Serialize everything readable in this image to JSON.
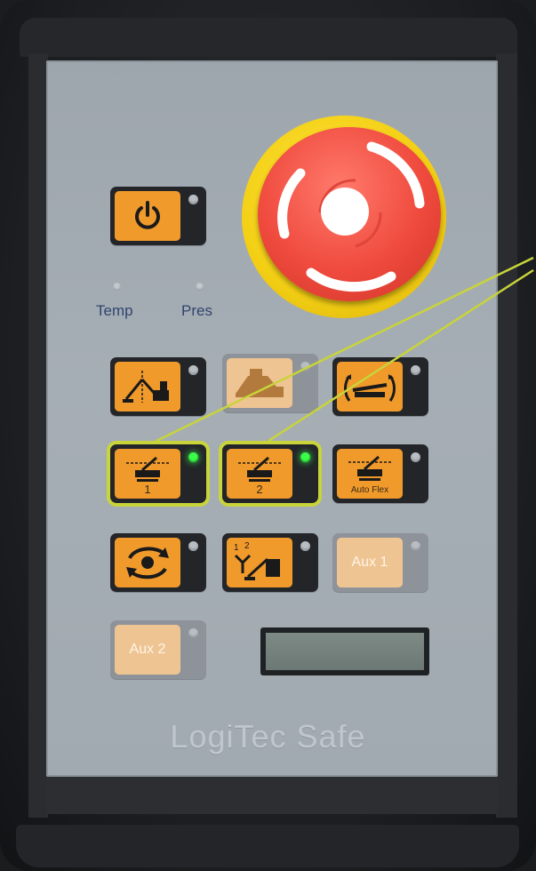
{
  "panel": {
    "brand": "LogiTec Safe",
    "indicators": [
      {
        "label": "Temp"
      },
      {
        "label": "Pres"
      }
    ],
    "buttons": {
      "power": {
        "icon": "power-icon",
        "led": "off"
      },
      "row1": [
        {
          "icon": "boom-position-icon",
          "led": "off"
        },
        {
          "icon": "transport-icon",
          "led": "off",
          "state": "disabled"
        },
        {
          "icon": "tilt-icon",
          "led": "off"
        }
      ],
      "row2": [
        {
          "icon": "cutting-unit-icon",
          "number": "1",
          "led": "on",
          "highlighted": true
        },
        {
          "icon": "cutting-unit-icon",
          "number": "2",
          "led": "on",
          "highlighted": true
        },
        {
          "icon": "cutting-unit-icon",
          "label": "Auto Flex",
          "led": "off"
        }
      ],
      "row3": [
        {
          "icon": "rotation-icon",
          "led": "off"
        },
        {
          "icon": "boom-sections-icon",
          "led": "off",
          "tag": "1 2"
        },
        {
          "label": "Aux 1",
          "led": "off",
          "state": "disabled"
        }
      ],
      "row4": [
        {
          "label": "Aux 2",
          "led": "off",
          "state": "disabled"
        }
      ]
    },
    "emergency_stop": {
      "icon": "emergency-stop-icon"
    },
    "display": {
      "text": ""
    },
    "colors": {
      "button": "#f09a2c",
      "button_disabled": "#efc493",
      "led_on": "#3cff4a",
      "highlight": "#c8d43a",
      "estop_red": "#ef4a3d",
      "estop_yellow": "#f3cf14"
    }
  }
}
